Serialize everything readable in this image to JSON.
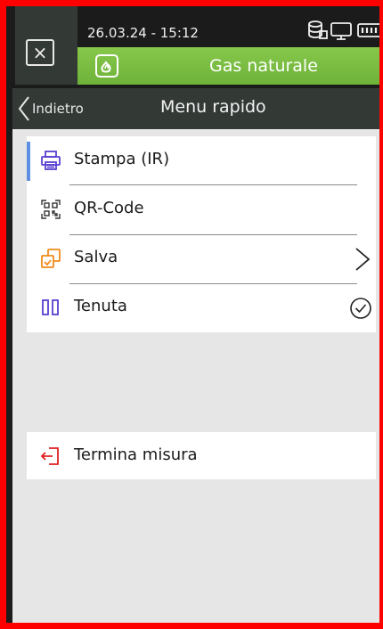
{
  "status": {
    "datetime": "26.03.24 - 15:12"
  },
  "header": {
    "close_symbol": "×",
    "app_title": "Gas naturale"
  },
  "navbar": {
    "back_label": "Indietro",
    "title": "Menu rapido"
  },
  "menu": {
    "items": [
      {
        "label": "Stampa (IR)",
        "icon": "printer-icon"
      },
      {
        "label": "QR-Code",
        "icon": "qr-code-icon"
      },
      {
        "label": "Salva",
        "icon": "save-icon",
        "trailing": "chevron-right-icon"
      },
      {
        "label": "Tenuta",
        "icon": "pause-icon",
        "trailing": "check-circle-icon"
      }
    ],
    "exit": {
      "label": "Termina misura",
      "icon": "exit-icon"
    }
  },
  "colors": {
    "accent_green": "#7bbf44",
    "selection_blue": "#5f8fe0",
    "frame_red": "#ff0000",
    "orange": "#f08a1c",
    "purple": "#5a3fd0",
    "red_icon": "#e02020"
  }
}
